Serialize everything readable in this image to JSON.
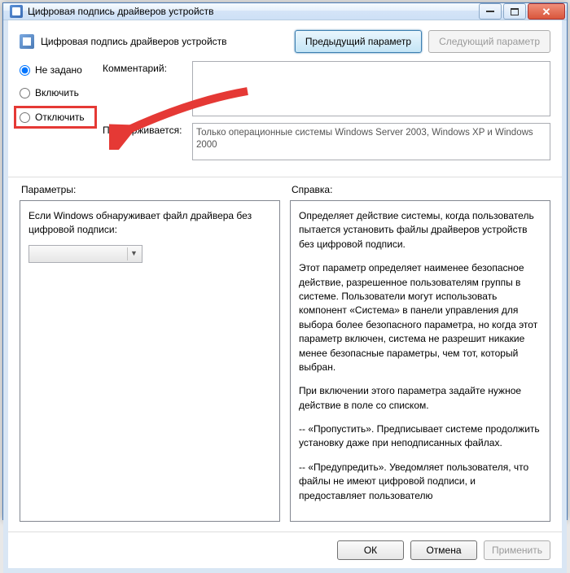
{
  "window": {
    "title": "Цифровая подпись драйверов устройств",
    "minimize_glyph": "",
    "maximize_glyph": "",
    "close_glyph": "✕"
  },
  "header": {
    "title": "Цифровая подпись драйверов устройств",
    "prev_setting": "Предыдущий параметр",
    "next_setting": "Следующий параметр"
  },
  "radio": {
    "not_configured": "Не задано",
    "enabled": "Включить",
    "disabled": "Отключить"
  },
  "fields": {
    "comment_label": "Комментарий:",
    "comment_value": "",
    "supported_label": "Поддерживается:",
    "supported_value": "Только операционные системы Windows Server 2003, Windows XP и Windows 2000"
  },
  "columns": {
    "params_title": "Параметры:",
    "help_title": "Справка:"
  },
  "params": {
    "desc": "Если Windows обнаруживает файл драйвера без цифровой подписи:",
    "combo_value": ""
  },
  "help": {
    "p1": "Определяет действие системы, когда пользователь пытается установить файлы драйверов устройств без цифровой подписи.",
    "p2": "Этот параметр определяет наименее безопасное действие, разрешенное пользователям группы в системе. Пользователи могут использовать компонент «Система» в панели управления для выбора более безопасного параметра, но когда этот параметр включен, система не разрешит никакие менее безопасные параметры, чем тот, который выбран.",
    "p3": "При включении этого параметра задайте нужное действие в поле со списком.",
    "p4": "--   «Пропустить». Предписывает системе продолжить установку даже при неподписанных файлах.",
    "p5": "--   «Предупредить». Уведомляет пользователя, что файлы не имеют цифровой подписи, и предоставляет пользователю"
  },
  "footer": {
    "ok": "ОК",
    "cancel": "Отмена",
    "apply": "Применить"
  }
}
